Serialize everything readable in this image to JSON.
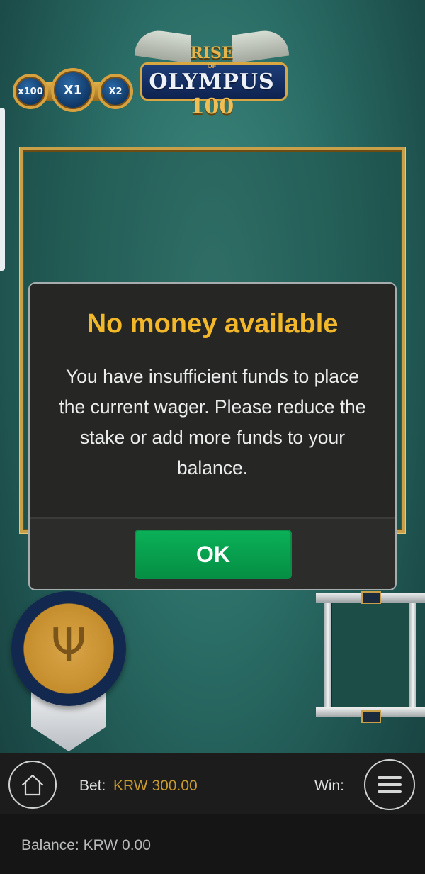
{
  "multipliers": [
    "x100",
    "X1",
    "X2"
  ],
  "logo": {
    "rise": "RISE",
    "of": "OF",
    "olympus": "OLYMPUS",
    "number": "100"
  },
  "dialog": {
    "title": "No money available",
    "message": "You have insufficient funds to place the current wager. Please reduce the stake or add more funds to your balance.",
    "ok_label": "OK"
  },
  "bottom_bar": {
    "bet_label": "Bet:",
    "bet_value": "KRW 300.00",
    "win_label": "Win:",
    "balance_label": "Balance:",
    "balance_value": "KRW 0.00"
  },
  "colors": {
    "title_yellow": "#f2b82a",
    "ok_green": "#0aa750",
    "bet_gold": "#c99b2f",
    "frame_gold": "#c9a04a"
  },
  "icons": {
    "home": "home-icon",
    "menu": "hamburger-menu-icon",
    "emblem": "trident-icon"
  }
}
